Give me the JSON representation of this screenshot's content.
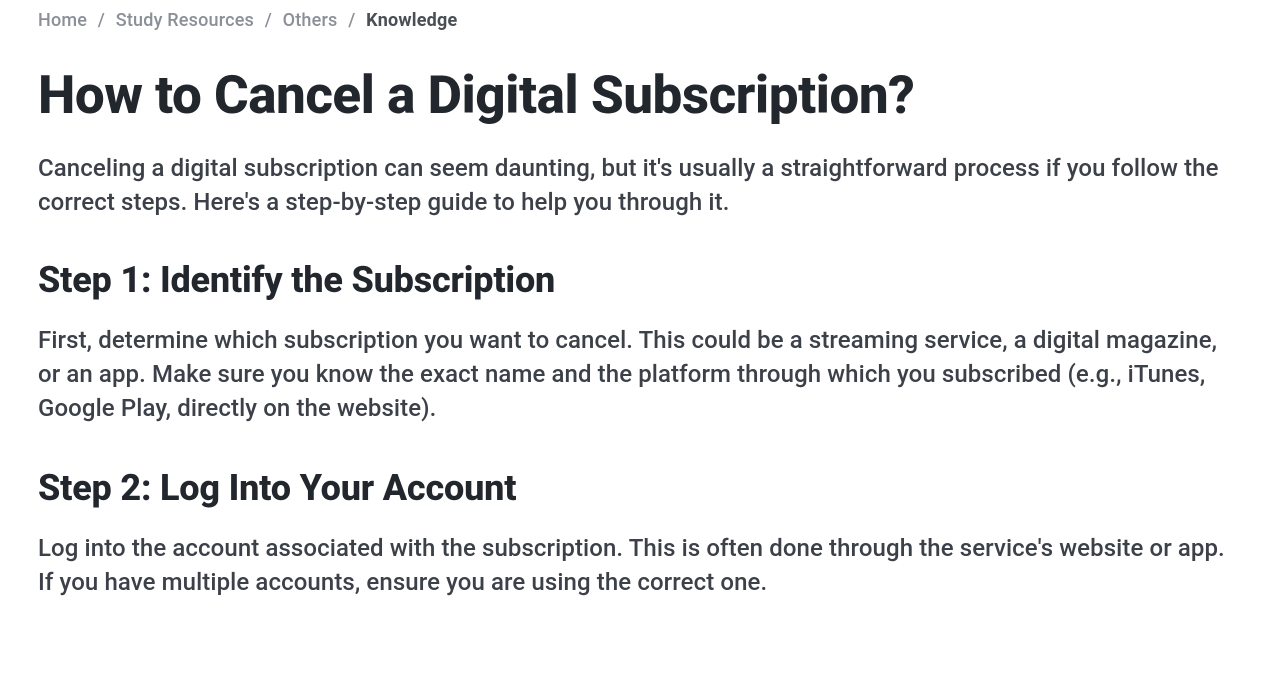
{
  "breadcrumb": {
    "items": [
      {
        "label": "Home"
      },
      {
        "label": "Study Resources"
      },
      {
        "label": "Others"
      }
    ],
    "current": "Knowledge",
    "separator": "/"
  },
  "article": {
    "title": "How to Cancel a Digital Subscription?",
    "intro": "Canceling a digital subscription can seem daunting, but it's usually a straightforward process if you follow the correct steps. Here's a step-by-step guide to help you through it.",
    "steps": [
      {
        "heading": "Step 1: Identify the Subscription",
        "body": "First, determine which subscription you want to cancel. This could be a streaming service, a digital magazine, or an app. Make sure you know the exact name and the platform through which you subscribed (e.g., iTunes, Google Play, directly on the website)."
      },
      {
        "heading": "Step 2: Log Into Your Account",
        "body": "Log into the account associated with the subscription. This is often done through the service's website or app. If you have multiple accounts, ensure you are using the correct one."
      }
    ]
  }
}
